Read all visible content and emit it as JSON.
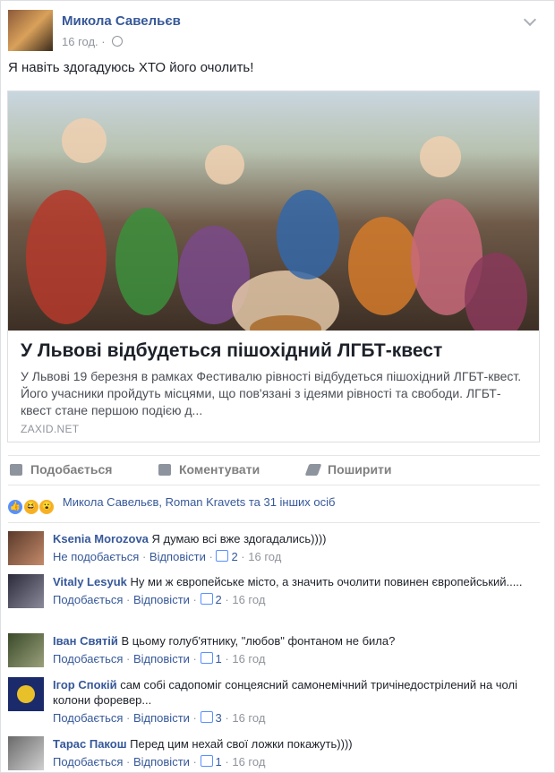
{
  "post": {
    "author": "Микола Савельєв",
    "time": "16 год.",
    "dot": "·",
    "text": "Я навіть здогадуюсь ХТО його очолить!"
  },
  "share": {
    "title": "У Львові відбудеться пішохідний ЛГБТ-квест",
    "description": "У Львові 19 березня в рамках Фестивалю рівності відбудеться пішохідний ЛГБТ-квест. Його учасники пройдуть місцями, що пов'язані з ідеями рівності та свободи. ЛГБТ-квест стане першою подією д...",
    "source": "ZAXID.NET"
  },
  "actions": {
    "like": "Подобається",
    "comment": "Коментувати",
    "share": "Поширити"
  },
  "reactions": {
    "text": "Микола Савельєв, Roman Kravets та 31 інших осіб"
  },
  "comments": [
    {
      "name": "Ksenia Morozova",
      "text": "Я думаю всі вже здогадались))))",
      "like_label": "Не подобається",
      "reply": "Відповісти",
      "likes": "2",
      "time": "16 год"
    },
    {
      "name": "Vitaly Lesyuk",
      "text": "Ну ми ж європейське місто, а значить очолити повинен європейський.....",
      "like_label": "Подобається",
      "reply": "Відповісти",
      "likes": "2",
      "time": "16 год"
    },
    {
      "name": "Іван Святій",
      "text": "В цьому голуб'ятнику, \"любов\" фонтаном не била?",
      "like_label": "Подобається",
      "reply": "Відповісти",
      "likes": "1",
      "time": "16 год"
    },
    {
      "name": "Ігор Спокій",
      "text": "сам собі садопоміг сонцеясний самонемічний тричінедострілений на чолі колони форевер...",
      "like_label": "Подобається",
      "reply": "Відповісти",
      "likes": "3",
      "time": "16 год"
    },
    {
      "name": "Тарас Пакош",
      "text": "Перед цим нехай свої ложки покажуть))))",
      "like_label": "Подобається",
      "reply": "Відповісти",
      "likes": "1",
      "time": "16 год"
    }
  ],
  "sep": "·"
}
